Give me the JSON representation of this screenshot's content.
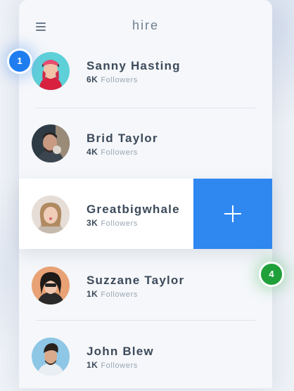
{
  "app": {
    "title": "hire"
  },
  "users": [
    {
      "name": "Sanny Hasting",
      "count": "6K",
      "followers_label": "Followers"
    },
    {
      "name": "Brid Taylor",
      "count": "4K",
      "followers_label": "Followers"
    },
    {
      "name": "Greatbigwhale",
      "count": "3K",
      "followers_label": "Followers"
    },
    {
      "name": "Suzzane Taylor",
      "count": "1K",
      "followers_label": "Followers"
    },
    {
      "name": "John Blew",
      "count": "1K",
      "followers_label": "Followers"
    }
  ],
  "badges": {
    "first": "1",
    "second": "4"
  },
  "colors": {
    "accent": "#2f87f0",
    "badge_blue": "#1f7df0",
    "badge_green": "#1fa03a"
  },
  "icons": {
    "menu": "hamburger-icon",
    "add": "plus-icon"
  }
}
